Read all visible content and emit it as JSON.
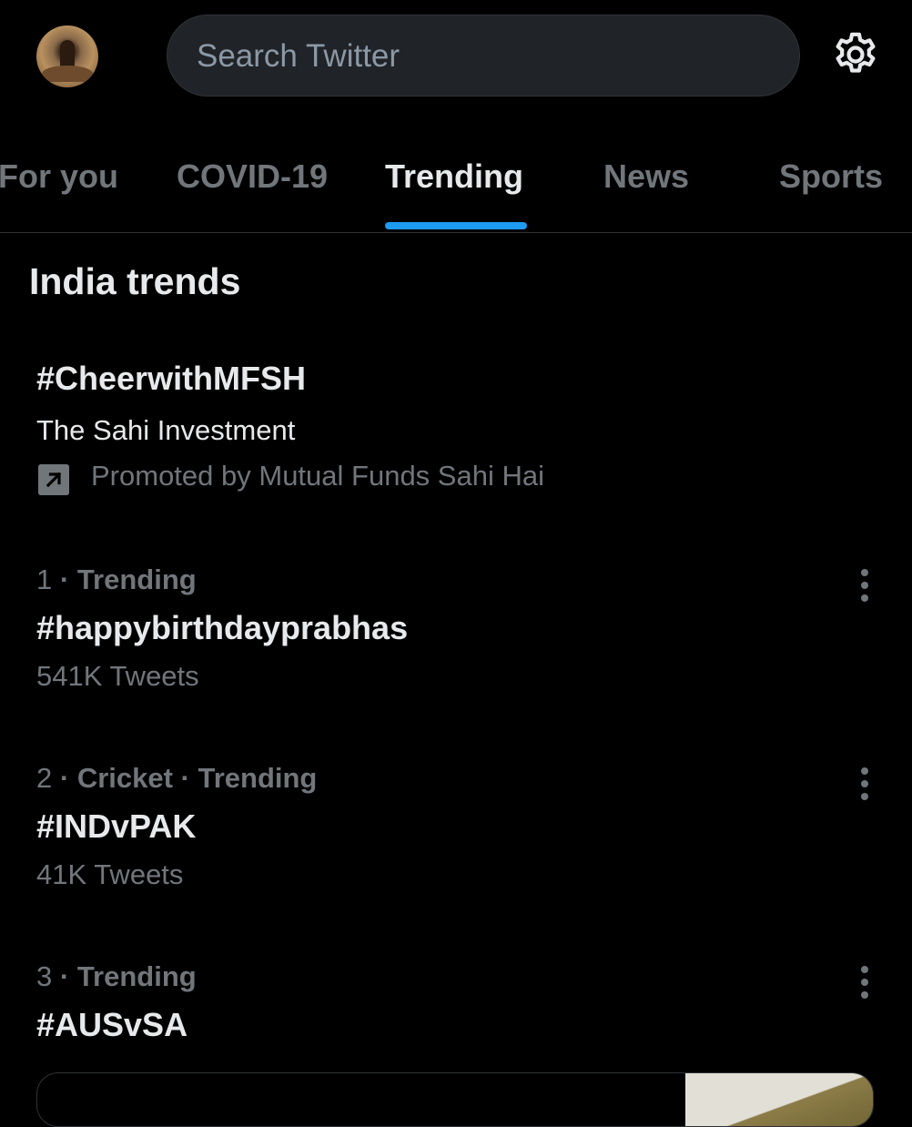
{
  "search": {
    "placeholder": "Search Twitter"
  },
  "tabs": [
    {
      "label": "For you",
      "active": false
    },
    {
      "label": "COVID-19",
      "active": false
    },
    {
      "label": "Trending",
      "active": true
    },
    {
      "label": "News",
      "active": false
    },
    {
      "label": "Sports",
      "active": false
    }
  ],
  "section": {
    "title": "India trends"
  },
  "promoted": {
    "tag": "#CheerwithMFSH",
    "description": "The Sahi Investment",
    "promoted_by": "Promoted by Mutual Funds Sahi Hai"
  },
  "trends": [
    {
      "rank": "1",
      "category": "",
      "status": "Trending",
      "tag": "#happybirthdayprabhas",
      "count": "541K Tweets"
    },
    {
      "rank": "2",
      "category": "Cricket",
      "status": "Trending",
      "tag": "#INDvPAK",
      "count": "41K Tweets"
    },
    {
      "rank": "3",
      "category": "",
      "status": "Trending",
      "tag": "#AUSvSA",
      "count": ""
    }
  ],
  "colors": {
    "background": "#000000",
    "accent": "#1d9bf0",
    "text": "#e7e9ea",
    "muted": "#71767b"
  },
  "icons": {
    "settings": "gear-icon",
    "more": "more-icon",
    "promoted": "promoted-icon"
  }
}
